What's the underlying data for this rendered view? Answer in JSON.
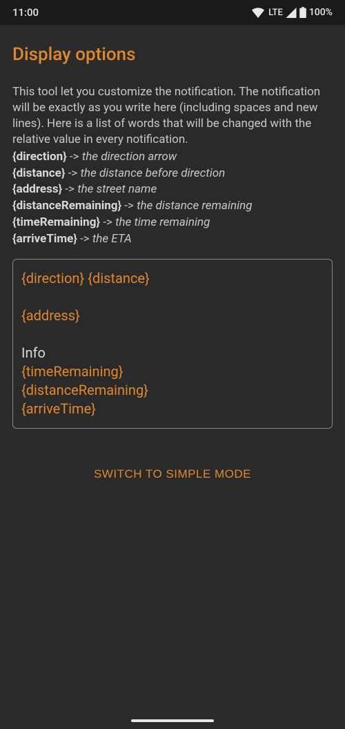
{
  "statusBar": {
    "time": "11:00",
    "network": "LTE",
    "battery": "100%"
  },
  "page": {
    "title": "Display options",
    "description": "This tool let you customize the notification. The notification will be exactly as you write here (including spaces and new lines). Here is a list of words that will be changed with the relative value in every notification.",
    "placeholders": [
      {
        "key": "{direction}",
        "desc": "the direction arrow"
      },
      {
        "key": "{distance}",
        "desc": "the distance before direction"
      },
      {
        "key": "{address}",
        "desc": "the street name"
      },
      {
        "key": "{distanceRemaining}",
        "desc": "the distance remaining"
      },
      {
        "key": "{timeRemaining}",
        "desc": "the time remaining"
      },
      {
        "key": "{arriveTime}",
        "desc": "the ETA"
      }
    ],
    "templateSegments": [
      {
        "type": "token",
        "text": "{direction}"
      },
      {
        "type": "plain",
        "text": " "
      },
      {
        "type": "token",
        "text": "{distance}"
      },
      {
        "type": "plain",
        "text": "\n\n"
      },
      {
        "type": "token",
        "text": "{address}"
      },
      {
        "type": "plain",
        "text": "\n\n"
      },
      {
        "type": "plain",
        "text": "Info\n"
      },
      {
        "type": "token",
        "text": "{timeRemaining}"
      },
      {
        "type": "plain",
        "text": "\n"
      },
      {
        "type": "token",
        "text": "{distanceRemaining}"
      },
      {
        "type": "plain",
        "text": "\n"
      },
      {
        "type": "token",
        "text": "{arriveTime}"
      }
    ],
    "switchButton": "SWITCH TO SIMPLE MODE"
  }
}
